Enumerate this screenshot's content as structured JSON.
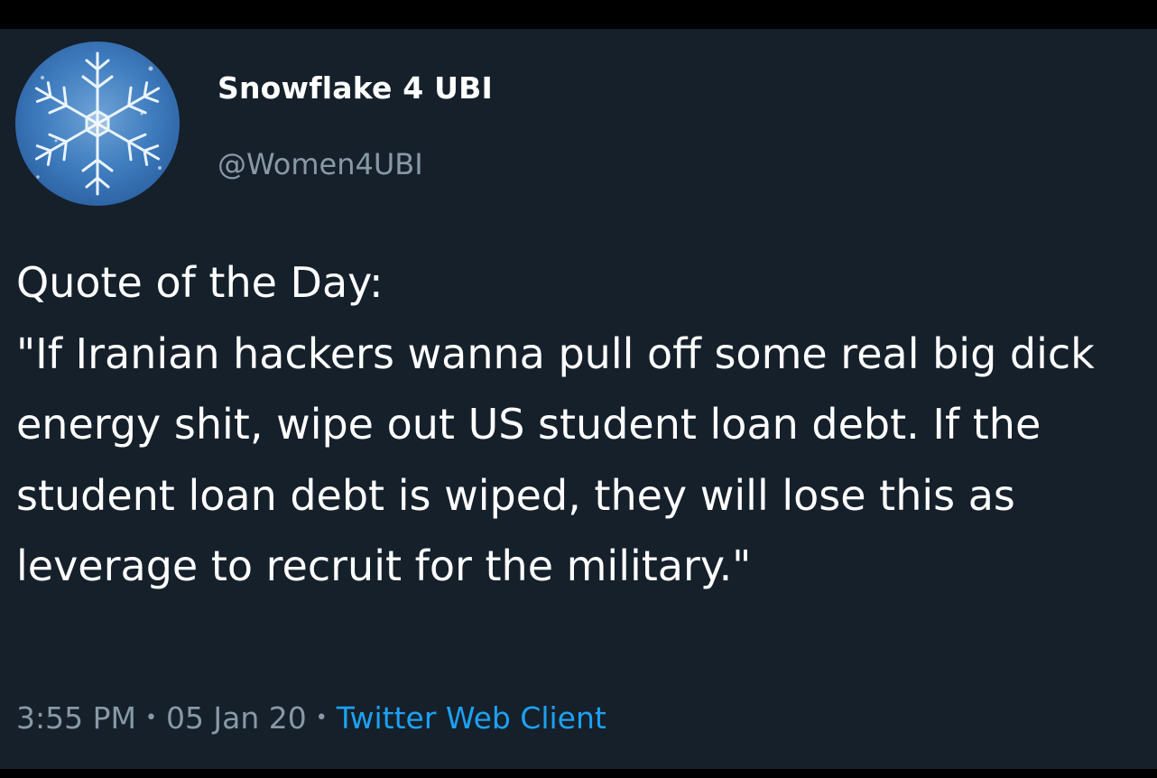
{
  "profile": {
    "display_name": "Snowflake 4 UBI",
    "handle": "@Women4UBI",
    "avatar_icon": "snowflake-icon"
  },
  "tweet": {
    "text": "Quote of the Day:\n\"If Iranian hackers wanna pull off some real big dick energy shit, wipe out US student loan debt. If the student loan debt is wiped, they will lose this as leverage to recruit for the military.\"",
    "time": "3:55 PM",
    "date": "05 Jan 20",
    "separator": "•",
    "source": "Twitter Web Client"
  },
  "colors": {
    "background": "#15202b",
    "text": "#ffffff",
    "secondary_text": "#8899a6",
    "link": "#1da1f2"
  }
}
